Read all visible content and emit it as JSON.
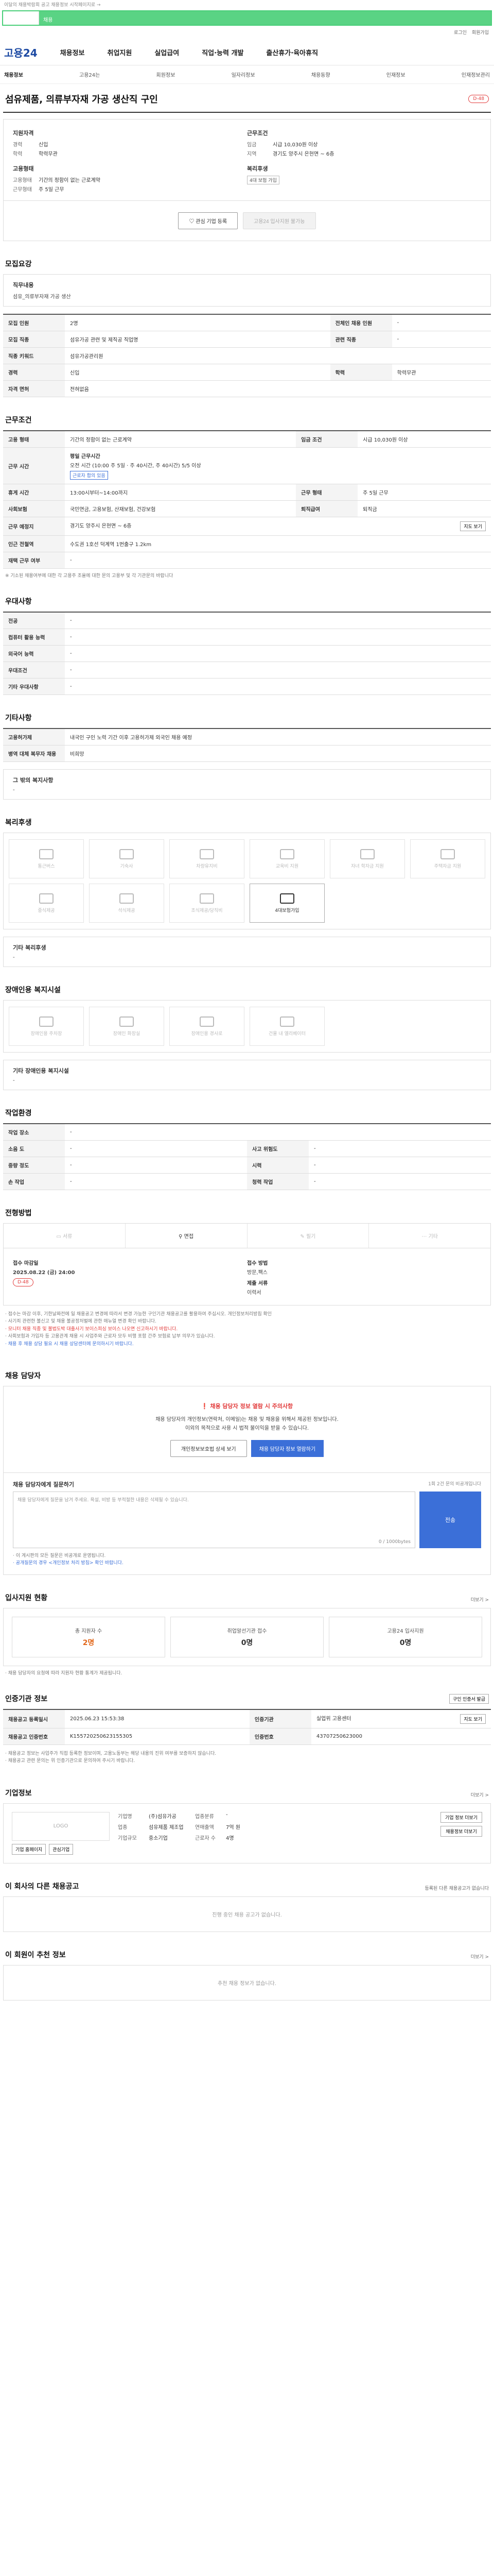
{
  "top_notice": "이달의 채용박람회 공고 채용정보 시작페이지로 →",
  "search": {
    "tab": "",
    "segment_label": "채용"
  },
  "util": {
    "login": "로그인",
    "signup": "회원가입"
  },
  "gnb": {
    "logo_a": "고용",
    "logo_b": "24",
    "menus": [
      "채용정보",
      "취업지원",
      "실업급여",
      "직업·능력 개발",
      "출산휴가·육아휴직"
    ]
  },
  "subnav": [
    "채용정보",
    "고용24는",
    "회원정보",
    "일자리정보",
    "채용동향",
    "인재정보",
    "인재정보관리"
  ],
  "job": {
    "title": "섬유제품, 의류부자재 가공 생산직 구인",
    "dday": "D-48"
  },
  "summary": {
    "left_head_1": "지원자격",
    "left_rows_1": [
      {
        "k": "경력",
        "v": "신입"
      },
      {
        "k": "학력",
        "v": "학력무관"
      }
    ],
    "left_head_2": "고용형태",
    "left_rows_2": [
      {
        "k": "고용형태",
        "v": "기간의 정함이 없는 근로계약"
      },
      {
        "k": "근무형태",
        "v": "주 5일 근무"
      }
    ],
    "right_head_1": "근무조건",
    "right_rows_1": [
      {
        "k": "임금",
        "v": "시급 10,030원 이상"
      },
      {
        "k": "지역",
        "v": "경기도 양주시 은현면 ~ 6층"
      }
    ],
    "right_head_2": "복리후생",
    "right_badge": "4대 보험 가입"
  },
  "buttons": {
    "interest": "관심 기업 등록",
    "apply": "고용24 입사지원 불가능"
  },
  "sections": {
    "recruit": "모집요강",
    "work_cond": "근무조건",
    "preference": "우대사항",
    "etc": "기타사항",
    "welfare": "복리후생",
    "disab": "장애인용 복지시설",
    "env": "작업환경",
    "method": "전형방법",
    "contact": "채용 담당자",
    "applicants": "입사지원 현황",
    "cert": "인증기관 정보",
    "company": "기업정보",
    "other_jobs": "이 회사의 다른 채용공고",
    "recommend": "이 회원이 추천 정보"
  },
  "recruit": {
    "duty_k": "직무내용",
    "duty_v": "섬유_의류부자재 가공 생산",
    "rows": [
      {
        "k": "모집 인원",
        "v": "2명",
        "k2": "전체인 채용 인원",
        "v2": "-"
      },
      {
        "k": "모집 직종",
        "v": "섬유가공 관련 및 제직공 직업명",
        "k2": "관련 직종",
        "v2": "-"
      },
      {
        "k": "직종 키워드",
        "v": "섬유가공관리원",
        "k2": "",
        "v2": ""
      },
      {
        "k": "경력",
        "v": "신입",
        "k2": "학력",
        "v2": "학력무관"
      },
      {
        "k": "자격 면허",
        "v": "전혀없음",
        "k2": "",
        "v2": ""
      }
    ]
  },
  "work": {
    "rows_top": [
      {
        "k": "고용 형태",
        "v": "기간의 정함이 없는 근로계약",
        "k2": "임금 조건",
        "v2": "시급 10,030원 이상"
      }
    ],
    "work_time_k": "근무 시간",
    "work_time_title": "평일 근무시간",
    "work_time_v": "오전 시간 (10:00 주 5일 · 주 40시간, 주 40시간) 5/5 이상",
    "work_time_tag": "근로자 합의 있음",
    "rows_mid": [
      {
        "k": "휴게 시간",
        "v": "13:00시부터~14:00까지",
        "k2": "근무 형태",
        "v2": "주 5일 근무"
      },
      {
        "k": "사회보험",
        "v": "국민연금, 고용보험, 산재보험, 건강보험",
        "k2": "퇴직급여",
        "v2": "퇴직금"
      },
      {
        "k": "근무 예정지",
        "v": "경기도 양주시 은현면 ~ 6층",
        "k2": "",
        "v2": ""
      },
      {
        "k": "인근 전철역",
        "v": "수도권 1호선 덕계역 1번출구 1.2km",
        "k2": "",
        "v2": ""
      },
      {
        "k": "재택 근무 여부",
        "v": "-",
        "k2": "",
        "v2": ""
      }
    ],
    "map_btn": "지도 보기",
    "note": "※ 기소된 채용여부에 대한 각 고용주 조율에 대한 문의 고용부 및 각 기관문의 바랍니다"
  },
  "pref": {
    "rows": [
      {
        "k": "전공",
        "v": "-"
      },
      {
        "k": "컴퓨터 활용 능력",
        "v": "-"
      },
      {
        "k": "외국어 능력",
        "v": "-"
      },
      {
        "k": "우대조건",
        "v": "-"
      },
      {
        "k": "기타 우대사항",
        "v": "-"
      }
    ]
  },
  "etc": {
    "rows": [
      {
        "k": "고용허가제",
        "v": "내국인 구인 노력 기간 이후 고용허가제 외국인 채용 예정"
      },
      {
        "k": "병역 대체 복무자 채용",
        "v": "비희망"
      }
    ],
    "other_k": "그 밖의 복지사항",
    "other_v": "-"
  },
  "welfare": {
    "items": [
      {
        "label": "통근버스",
        "on": false
      },
      {
        "label": "기숙사",
        "on": false
      },
      {
        "label": "차량유지비",
        "on": false
      },
      {
        "label": "교육비 지원",
        "on": false
      },
      {
        "label": "자녀 학자금 지원",
        "on": false
      },
      {
        "label": "주택자금 지원",
        "on": false
      },
      {
        "label": "중식제공",
        "on": false
      },
      {
        "label": "석식제공",
        "on": false
      },
      {
        "label": "조식제공/당직비",
        "on": false
      },
      {
        "label": "4대보험가입",
        "on": true
      }
    ],
    "other_k": "기타 복리후생",
    "other_v": "-"
  },
  "disab": {
    "items": [
      "장애인용 주차장",
      "장애인 화장실",
      "장애인용 경사로",
      "건물 내 엘리베이터"
    ],
    "other_k": "기타 장애인용 복지시설",
    "other_v": "-"
  },
  "env": {
    "rows": [
      {
        "k": "작업 장소",
        "v": "-",
        "k2": "",
        "v2": ""
      },
      {
        "k": "소음 도",
        "v": "-",
        "k2": "사고 위험도",
        "v2": "-"
      },
      {
        "k": "중량 정도",
        "v": "-",
        "k2": "시력",
        "v2": "-"
      },
      {
        "k": "손 작업",
        "v": "-",
        "k2": "청력 작업",
        "v2": "-"
      }
    ]
  },
  "method": {
    "tabs": [
      {
        "label": "서류",
        "on": false
      },
      {
        "label": "면접",
        "on": true
      },
      {
        "label": "필기",
        "on": false
      },
      {
        "label": "기타",
        "on": false
      }
    ],
    "deadline_k": "접수 마감일",
    "deadline_v": "2025.08.22 (금) 24:00",
    "deadline_tag": "D-48",
    "way_k": "접수 방법",
    "way_v": "방문,팩스",
    "docs_k": "제출 서류",
    "docs_v": "이력서",
    "notes": [
      "· 접수는 마감 이후, 기한날짜전에 일 채용공고 변경에 따라서 변경 가능한 구인기관 채용공고를 활용하여 주십시오. 개인정보처리방침 확인",
      "· 사기죄 관련한 불신고 및 채용 불공정처벌에 관한 매뉴얼 변경 확인 바랍니다.",
      "· 모니터 채용 직종 및 불법도박 대출사기 보이스피싱 보이스 나오면 신고하시기 바랍니다.",
      "· 사회보험과 가입자 등 고용관계 채용 시 사업주와 근로자 모두 비행 포함 간주 보험료 납부 의무가 있습니다.",
      "· 채용 후 채용 상담 필요 시 채용 상담센터에 문의하시기 바랍니다."
    ]
  },
  "contact": {
    "warn": "채용 담당자 정보 열람 시 주의사항",
    "line1": "채용 담당자의 개인정보(연락처, 이메일)는 채용 및 채용을 위해서 제공된 정보입니다.",
    "line2": "이외의 목적으로 사용 시 법적 불이익을 받을 수 있습니다.",
    "btn1": "개인정보보호법 상세 보기",
    "btn2": "채용 담당자 정보 열람하기"
  },
  "qna": {
    "title": "채용 담당자에게 질문하기",
    "sub": "1회 2건 문의 비공개입니다",
    "placeholder": "채용 담당자에게 질문을 남겨 주세요. 욕설, 비방 등 부적절한 내용은 삭제될 수 있습니다.",
    "count": "0 / 1000bytes",
    "submit": "전송",
    "note1": "· 이 게시판의 모든 질문은 비공개로 운영됩니다.",
    "note2": "· 공개질문의 경우 <개인정보 처리 방침> 확인 바랍니다."
  },
  "applicants": {
    "more": "더보기 >",
    "stats": [
      {
        "k": "총 지원자 수",
        "v": "2명",
        "orange": true
      },
      {
        "k": "취업알선기관 접수",
        "v": "0명",
        "orange": false
      },
      {
        "k": "고용24 입사지원",
        "v": "0명",
        "orange": false
      }
    ],
    "note": "· 채용 담당자의 요청에 따라 지원자 현황 통계가 제공됩니다."
  },
  "cert": {
    "btn": "구인 인증서 발급",
    "rows": [
      {
        "k": "채용공고 등록일시",
        "v": "2025.06.23 15:53:38",
        "k2": "인증기관",
        "v2": "실업위 고용센터"
      },
      {
        "k": "채용공고 인증번호",
        "v": "K155720250623155305",
        "k2": "인증번호",
        "v2": "43707250623000"
      }
    ],
    "map_btn": "지도 보기",
    "notes": [
      "· 채용공고 정보는 사업주가 직접 등록한 정보이며, 고용노동부는 해당 내용의 진위 여부를 보증하지 않습니다.",
      "· 채용공고 관련 문의는 위 인증기관으로 문의하여 주시기 바랍니다."
    ]
  },
  "company": {
    "more": "더보기 >",
    "logo": "LOGO",
    "logo_btn1": "기업 홈페이지",
    "logo_btn2": "관심기업",
    "info": [
      {
        "k": "기업명",
        "v": "(주)섬유가공",
        "k2": "업종분류",
        "v2": "-"
      },
      {
        "k": "업종",
        "v": "섬유제품 제조업",
        "k2": "연매출액",
        "v2": "7억 원"
      },
      {
        "k": "기업규모",
        "v": "중소기업",
        "k2": "근로자 수",
        "v2": "4명"
      }
    ],
    "btn1": "기업 정보 더보기",
    "btn2": "채용정보 더보기"
  },
  "other_jobs": {
    "more": "등록된 다른 채용공고가 없습니다",
    "empty": "진행 중인 채용 공고가 없습니다."
  },
  "recommend": {
    "more": "더보기 >",
    "empty": "추천 채용 정보가 없습니다."
  }
}
